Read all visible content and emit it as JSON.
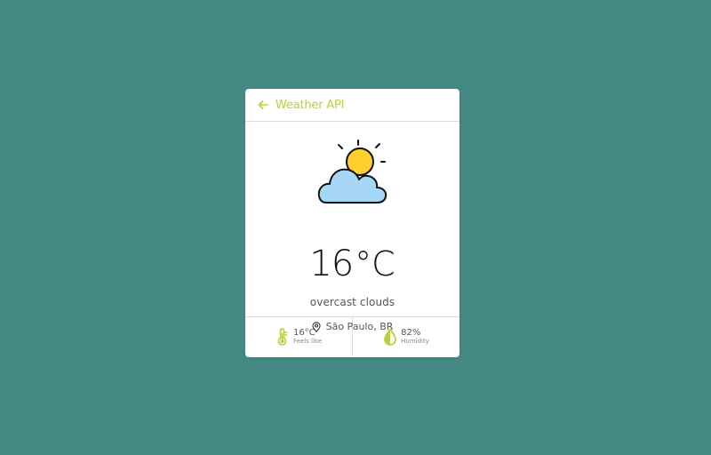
{
  "header": {
    "title": "Weather API",
    "back_icon": "arrow-left-icon"
  },
  "weather": {
    "icon": "partly-cloudy-icon",
    "temperature": "16",
    "unit": "°C",
    "description": "overcast clouds",
    "location": "São Paulo, BR",
    "location_icon": "map-pin-icon"
  },
  "stats": {
    "feels_like": {
      "value": "16°C",
      "label": "Feels like",
      "icon": "thermometer-icon"
    },
    "humidity": {
      "value": "82%",
      "label": "Humidity",
      "icon": "humidity-drop-icon"
    }
  },
  "colors": {
    "background": "#458985",
    "accent": "#b7d33a",
    "sun": "#ffd02f",
    "cloud": "#a7d7f6"
  }
}
